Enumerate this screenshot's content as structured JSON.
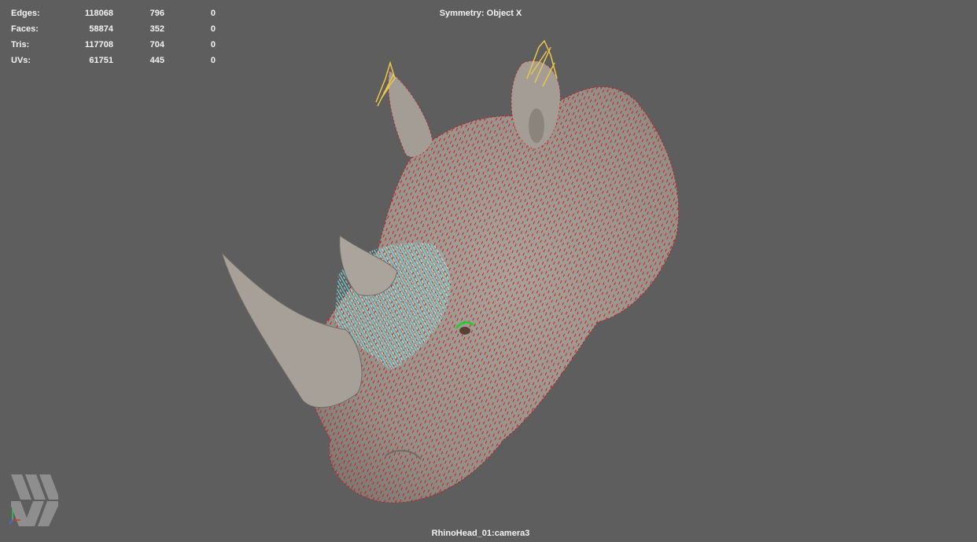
{
  "hud": {
    "rows": [
      {
        "label": "Edges:",
        "v1": "118068",
        "v2": "796",
        "v3": "0"
      },
      {
        "label": "Faces:",
        "v1": "58874",
        "v2": "352",
        "v3": "0"
      },
      {
        "label": "Tris:",
        "v1": "117708",
        "v2": "704",
        "v3": "0"
      },
      {
        "label": "UVs:",
        "v1": "61751",
        "v2": "445",
        "v3": "0"
      }
    ]
  },
  "viewport": {
    "symmetry": "Symmetry: Object X",
    "camera": "RhinoHead_01:camera3"
  },
  "colors": {
    "background": "#5e5e5e",
    "mesh": "#9a948d",
    "wire": "#d01515",
    "selected_hair": "#5ce6e6",
    "ear_hair": "#e8c84a",
    "eye_lashes": "#1fd11f"
  },
  "icons": {
    "logo": "app-logo-icon",
    "axis": "axis-gizmo-icon"
  }
}
